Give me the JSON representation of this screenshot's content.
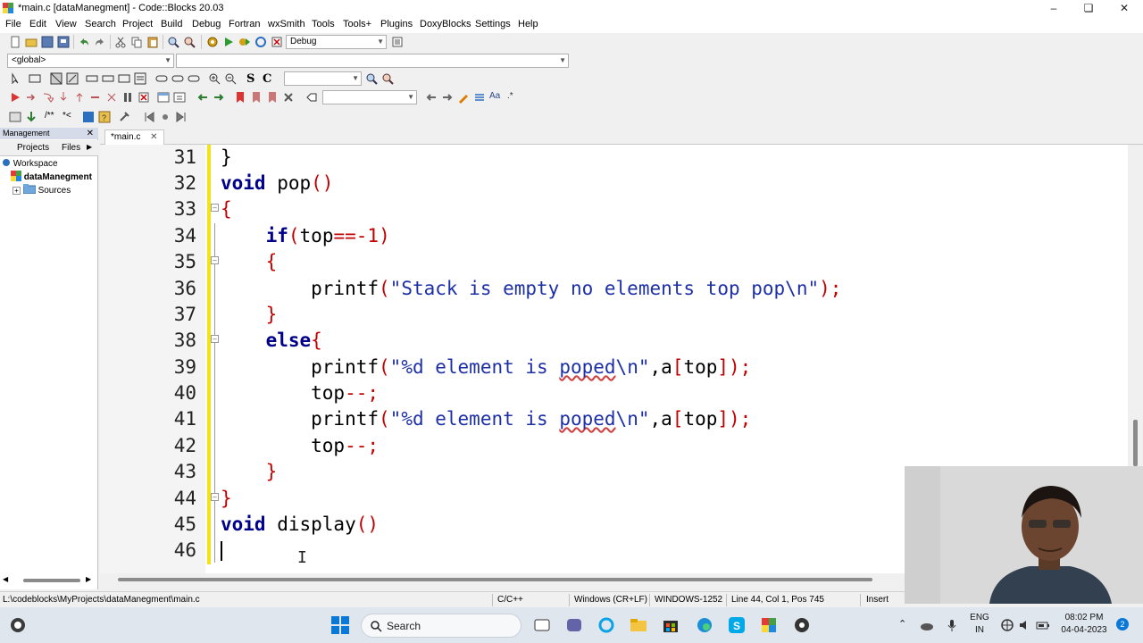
{
  "window": {
    "title": "*main.c [dataManegment] - Code::Blocks 20.03",
    "controls": [
      "minimize",
      "maximize",
      "close"
    ]
  },
  "menu": [
    "File",
    "Edit",
    "View",
    "Search",
    "Project",
    "Build",
    "Debug",
    "Fortran",
    "wxSmith",
    "Tools",
    "Tools+",
    "Plugins",
    "DoxyBlocks",
    "Settings",
    "Help"
  ],
  "toolbar": {
    "build_target": "Debug",
    "scope": "<global>"
  },
  "management": {
    "title": "Management",
    "tabs": [
      "Projects",
      "Files"
    ],
    "tree": {
      "workspace": "Workspace",
      "project": "dataManegment",
      "folder": "Sources"
    }
  },
  "editor": {
    "tab_label": "*main.c",
    "lines": [
      {
        "no": "31",
        "code": "}"
      },
      {
        "no": "32",
        "code": "void pop()"
      },
      {
        "no": "33",
        "code": "{"
      },
      {
        "no": "34",
        "code": "    if(top==-1)"
      },
      {
        "no": "35",
        "code": "    {"
      },
      {
        "no": "36",
        "code": "        printf(\"Stack is empty no elements top pop\\n\");"
      },
      {
        "no": "37",
        "code": "    }"
      },
      {
        "no": "38",
        "code": "    else{"
      },
      {
        "no": "39",
        "code": "        printf(\"%d element is poped\\n\",a[top]);"
      },
      {
        "no": "40",
        "code": "        top--;"
      },
      {
        "no": "41",
        "code": "        printf(\"%d element is poped\\n\",a[top]);"
      },
      {
        "no": "42",
        "code": "        top--;"
      },
      {
        "no": "43",
        "code": "    }"
      },
      {
        "no": "44",
        "code": "}"
      },
      {
        "no": "45",
        "code": "void display()"
      },
      {
        "no": "46",
        "code": ""
      }
    ]
  },
  "statusbar": {
    "path": "L:\\codeblocks\\MyProjects\\dataManegment\\main.c",
    "language": "C/C++",
    "line_endings": "Windows (CR+LF)",
    "encoding": "WINDOWS-1252",
    "position": "Line 44, Col 1, Pos 745",
    "mode": "Insert"
  },
  "taskbar": {
    "search_label": "Search",
    "language": "ENG",
    "region": "IN",
    "time": "08:02 PM",
    "date": "04-04-2023",
    "notifications": "2"
  },
  "colors": {
    "keyword": "#00008b",
    "string": "#1d2fa6",
    "operator": "#c30000",
    "changebar": "#f3e31c"
  }
}
